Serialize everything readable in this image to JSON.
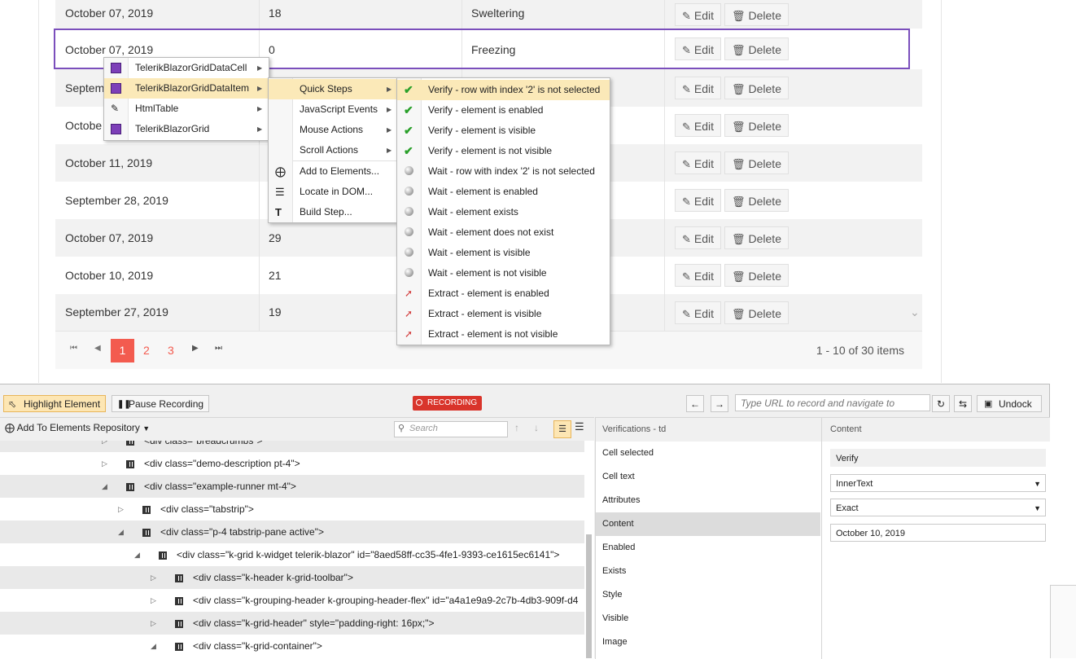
{
  "grid": {
    "rows": [
      {
        "date": "October 07, 2019",
        "value": "18",
        "status": "Sweltering"
      },
      {
        "date": "October 07, 2019",
        "value": "0",
        "status": "Freezing"
      },
      {
        "date": "Septem",
        "value": "",
        "status": ""
      },
      {
        "date": "Octobe",
        "value": "",
        "status": ""
      },
      {
        "date": "October 11, 2019",
        "value": "",
        "status": ""
      },
      {
        "date": "September 28, 2019",
        "value": "",
        "status": ""
      },
      {
        "date": "October 07, 2019",
        "value": "29",
        "status": ""
      },
      {
        "date": "October 10, 2019",
        "value": "21",
        "status": ""
      },
      {
        "date": "September 27, 2019",
        "value": "19",
        "status": ""
      }
    ],
    "edit_label": "Edit",
    "delete_label": "Delete",
    "pager": {
      "pages": [
        "1",
        "2",
        "3"
      ],
      "current": "1",
      "summary": "1 - 10 of 30 items"
    }
  },
  "menu1": {
    "items": [
      "TelerikBlazorGridDataCell",
      "TelerikBlazorGridDataItem",
      "HtmlTable",
      "TelerikBlazorGrid"
    ]
  },
  "menu2": {
    "items": [
      "Quick Steps",
      "JavaScript Events",
      "Mouse Actions",
      "Scroll Actions"
    ],
    "actions": [
      "Add to Elements...",
      "Locate in DOM...",
      "Build Step..."
    ]
  },
  "menu3": {
    "items": [
      {
        "label": "Verify - row with index '2' is not selected",
        "icon": "check-icon"
      },
      {
        "label": "Verify - element is enabled",
        "icon": "check-icon"
      },
      {
        "label": "Verify - element is visible",
        "icon": "check-icon"
      },
      {
        "label": "Verify - element is not visible",
        "icon": "check-icon"
      },
      {
        "label": "Wait - row with index '2' is not selected",
        "icon": "wait-icon"
      },
      {
        "label": "Wait - element is enabled",
        "icon": "wait-icon"
      },
      {
        "label": "Wait - element exists",
        "icon": "wait-icon"
      },
      {
        "label": "Wait - element does not exist",
        "icon": "wait-icon"
      },
      {
        "label": "Wait - element is visible",
        "icon": "wait-icon"
      },
      {
        "label": "Wait - element is not visible",
        "icon": "wait-icon"
      },
      {
        "label": "Extract - element is enabled",
        "icon": "extract-icon"
      },
      {
        "label": "Extract - element is visible",
        "icon": "extract-icon"
      },
      {
        "label": "Extract - element is not visible",
        "icon": "extract-icon"
      }
    ]
  },
  "recorder": {
    "highlight_label": "Highlight Element",
    "pause_label": "Pause Recording",
    "recording_badge": "RECORDING",
    "url_placeholder": "Type URL to record and navigate to",
    "undock_label": "Undock",
    "add_repo_label": "Add To Elements Repository",
    "search_placeholder": "Search",
    "tree": [
      "<div class=\"breadcrumbs\">",
      "<div class=\"demo-description pt-4\">",
      "<div class=\"example-runner mt-4\">",
      "<div class=\"tabstrip\">",
      "<div class=\"p-4 tabstrip-pane active\">",
      "<div class=\"k-grid k-widget telerik-blazor\" id=\"8aed58ff-cc35-4fe1-9393-ce1615ec6141\">",
      "<div class=\"k-header k-grid-toolbar\">",
      "<div class=\"k-grouping-header k-grouping-header-flex\" id=\"a4a1e9a9-2c7b-4db3-909f-d4",
      "<div class=\"k-grid-header\" style=\"padding-right: 16px;\">",
      "<div class=\"k-grid-container\">"
    ],
    "verifications_title": "Verifications - td",
    "verifications": [
      "Cell selected",
      "Cell text",
      "Attributes",
      "Content",
      "Enabled",
      "Exists",
      "Style",
      "Visible",
      "Image"
    ],
    "content_title": "Content",
    "content_action": "Verify",
    "content_property": "InnerText",
    "content_compare": "Exact",
    "content_value": "October 10, 2019"
  },
  "colors": {
    "selection": "#7b4fbc",
    "pager_current": "#f35b4f",
    "recording": "#d9342b",
    "menu_highlight": "#fbe9b8"
  }
}
